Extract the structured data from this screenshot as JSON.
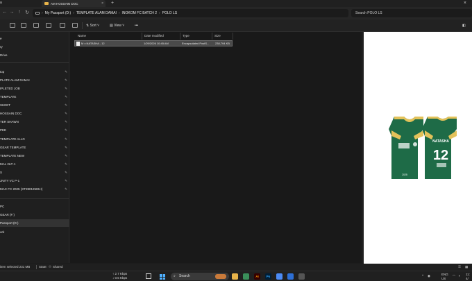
{
  "window": {
    "tab_title": "AM HOSSAIN DOC",
    "title_left": "a"
  },
  "address": {
    "crumbs": [
      "My Passport (D:)",
      "TEMPLATE ALAM DAMAI",
      "INOKOM FC BATCH 2",
      "POLO LS"
    ],
    "search_placeholder": "Search POLO LS"
  },
  "toolbar": {
    "sort_label": "Sort",
    "view_label": "View",
    "more_label": "•••"
  },
  "sidebar": {
    "items": [
      {
        "label": "e",
        "pinned": false
      },
      {
        "label": "ry",
        "pinned": false
      },
      {
        "label": "Drive",
        "pinned": false
      },
      {
        "label": "top",
        "pinned": true
      },
      {
        "label": "PLATE ALAM DAMAI",
        "pinned": true
      },
      {
        "label": "IPLETED JOB",
        "pinned": true
      },
      {
        "label": "TEMPLATE",
        "pinned": true
      },
      {
        "label": "SHEET",
        "pinned": true
      },
      {
        "label": "HOSSAIN DOC",
        "pinned": true
      },
      {
        "label": "TER SHAWN",
        "pinned": true
      },
      {
        "label": "PEE",
        "pinned": true
      },
      {
        "label": "TEMPLATE ALLG",
        "pinned": true
      },
      {
        "label": "GEAR TEMPLATE",
        "pinned": true
      },
      {
        "label": "TEMPLATE NEW",
        "pinned": true
      },
      {
        "label": "MAL 2LP-1",
        "pinned": true
      },
      {
        "label": "S",
        "pinned": true
      },
      {
        "label": "JNITY VC P-1",
        "pinned": true
      },
      {
        "label": "MAC FC 2025 (XT28012506-I)",
        "pinned": true
      },
      {
        "label": "PC",
        "pinned": false
      },
      {
        "label": "GEAR (F:)",
        "pinned": false
      },
      {
        "label": "Passport (D:)",
        "pinned": false
      },
      {
        "label": "ork",
        "pinned": false
      }
    ]
  },
  "filelist": {
    "columns": [
      "Name",
      "Date modified",
      "Type",
      "Size"
    ],
    "rows": [
      {
        "name": "M x NATASHA - 12",
        "date": "1/29/2026 10:45 AM",
        "type": "Encapsulated PostS...",
        "size": "238,794 KB"
      }
    ]
  },
  "preview": {
    "jersey_color": "#1e6b47",
    "trim_color": "#e3c25a",
    "back_name": "NATASHA",
    "back_number": "12",
    "front_text": "2025"
  },
  "status": {
    "selected": "item selected  231 MB",
    "state": "State:",
    "shared": "Shared"
  },
  "taskbar": {
    "net_up": "↑ 2.7 Kbps",
    "net_down": "↓ 0.5 Kbps",
    "search_label": "Search",
    "lang_top": "ENG",
    "lang_bottom": "US",
    "clock_top": "11:",
    "clock_bottom": "4/"
  }
}
